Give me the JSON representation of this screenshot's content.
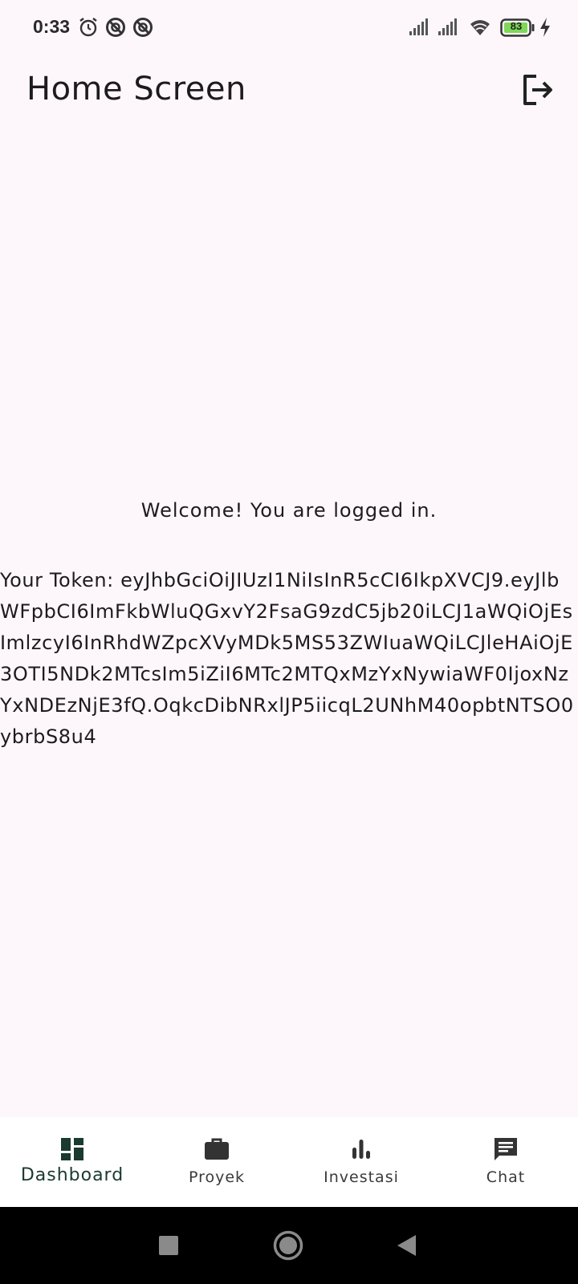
{
  "status_bar": {
    "time": "0:33",
    "battery_level": "83",
    "icons": [
      "alarm-icon",
      "do-not-disturb-icon",
      "do-not-disturb-icon",
      "signal-icon",
      "signal-icon",
      "wifi-icon",
      "battery-icon",
      "charging-icon"
    ]
  },
  "app_bar": {
    "title": "Home Screen",
    "action_icon": "logout-icon"
  },
  "content": {
    "welcome": "Welcome! You are logged in.",
    "token_text": "Your Token: eyJhbGciOiJIUzI1NiIsInR5cCI6IkpXVCJ9.eyJlbWFpbCI6ImFkbWluQGxvY2FsaG9zdC5jb20iLCJ1aWQiOjEsImlzcyI6InRhdWZpcXVyMDk5MS53ZWIuaWQiLCJleHAiOjE3OTI5NDk2MTcsIm5iZiI6MTc2MTQxMzYxNywiaWF0IjoxNzYxNDEzNjE3fQ.OqkcDibNRxlJP5iicqL2UNhM40opbtNTSO0ybrbS8u4"
  },
  "bottom_nav": {
    "items": [
      {
        "label": "Dashboard",
        "icon": "dashboard-icon",
        "active": true
      },
      {
        "label": "Proyek",
        "icon": "briefcase-icon",
        "active": false
      },
      {
        "label": "Investasi",
        "icon": "bar-chart-icon",
        "active": false
      },
      {
        "label": "Chat",
        "icon": "chat-icon",
        "active": false
      }
    ],
    "active_color": "#1a3a30"
  },
  "system_nav": {
    "buttons": [
      "recents-icon",
      "home-icon",
      "back-icon"
    ]
  }
}
